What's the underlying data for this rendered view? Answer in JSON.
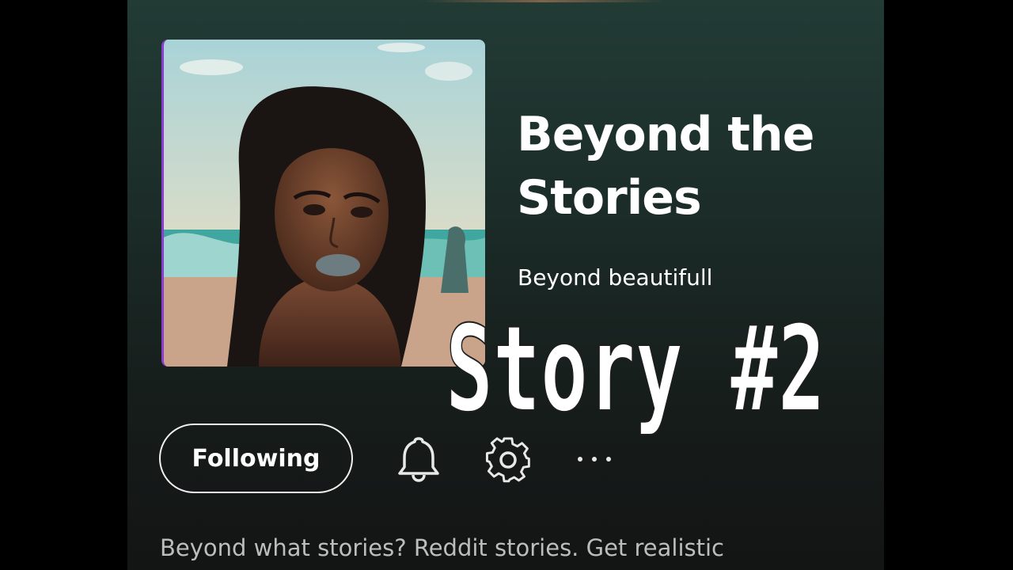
{
  "podcast": {
    "title": "Beyond the Stories",
    "author": "Beyond beautifull",
    "description": "Beyond what stories? Reddit stories. Get realistic"
  },
  "overlay": {
    "text": "Story #2"
  },
  "actions": {
    "follow_label": "Following",
    "notifications_icon": "bell-icon",
    "settings_icon": "gear-icon",
    "more_icon": "more-options-icon"
  },
  "colors": {
    "background_top": "#223b35",
    "background_bottom": "#131414",
    "text_primary": "#ffffff",
    "text_secondary": "#bdbdbd",
    "cover_accent": "#8a3fd1"
  }
}
